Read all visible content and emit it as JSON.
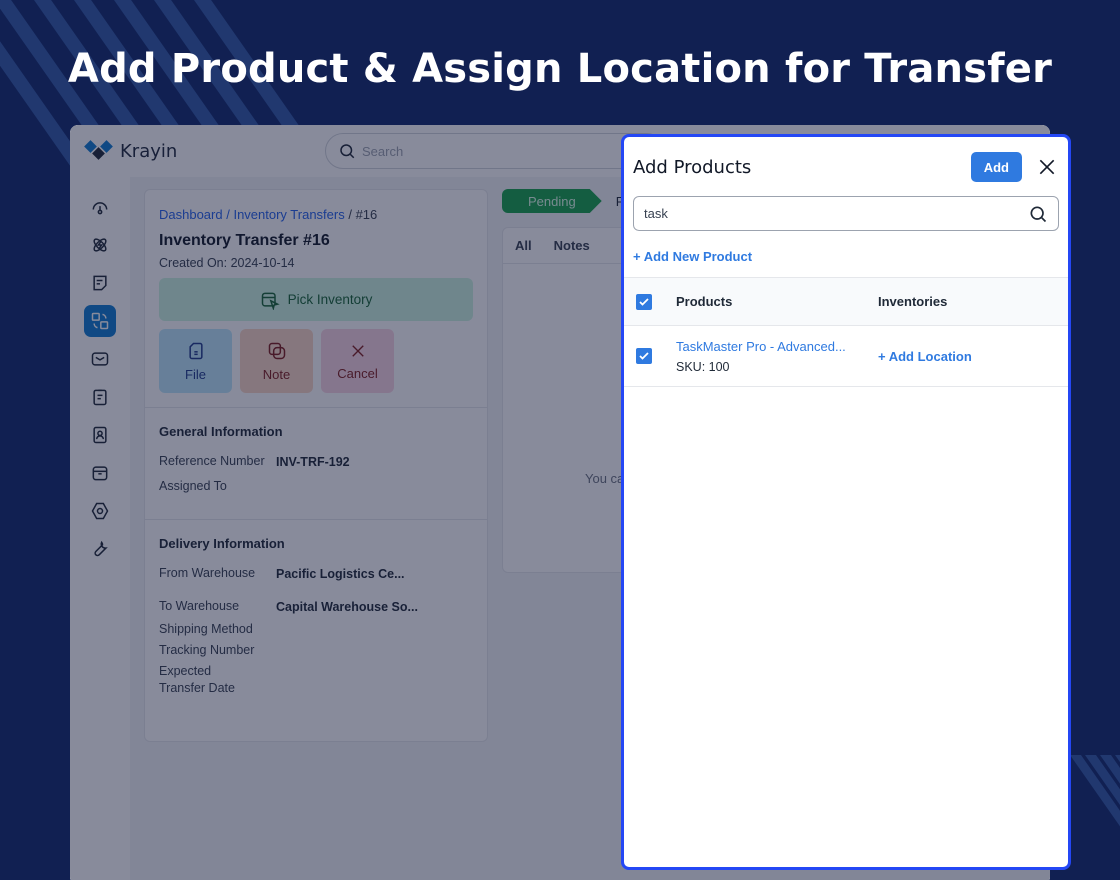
{
  "headline": "Add Product & Assign Location for Transfer",
  "app": {
    "brand": "Krayin",
    "search_placeholder": "Search",
    "sidebar": [
      {
        "icon": "dashboard-gauge-icon",
        "active": false
      },
      {
        "icon": "activity-atom-icon",
        "active": false
      },
      {
        "icon": "note-sticky-icon",
        "active": false
      },
      {
        "icon": "inventory-transfer-icon",
        "active": true
      },
      {
        "icon": "mail-icon",
        "active": false
      },
      {
        "icon": "clipboard-icon",
        "active": false
      },
      {
        "icon": "contacts-icon",
        "active": false
      },
      {
        "icon": "archive-box-icon",
        "active": false
      },
      {
        "icon": "settings-hex-icon",
        "active": false
      },
      {
        "icon": "wrench-icon",
        "active": false
      }
    ]
  },
  "transfer": {
    "breadcrumb": {
      "dashboard": "Dashboard",
      "sep1": " / ",
      "transfers": "Inventory Transfers",
      "sep2": " / ",
      "current": "#16"
    },
    "title": "Inventory Transfer #16",
    "created_on": "Created On: 2024-10-14",
    "pick_inventory": "Pick Inventory",
    "actions": {
      "file": "File",
      "note": "Note",
      "cancel": "Cancel"
    },
    "general": {
      "title": "General Information",
      "reference_label": "Reference Number",
      "reference_value": "INV-TRF-192",
      "assigned_label": "Assigned To",
      "assigned_value": ""
    },
    "delivery": {
      "title": "Delivery Information",
      "from_label": "From Warehouse",
      "from_value": "Pacific Logistics Ce...",
      "to_label": "To Warehouse",
      "to_value": "Capital Warehouse So...",
      "shipping_label": "Shipping Method",
      "tracking_label": "Tracking Number",
      "expected_label": "Expected Transfer Date"
    },
    "status": {
      "current": "Pending",
      "next": "P"
    },
    "tabs": {
      "all": "All",
      "notes": "Notes"
    },
    "empty_text": "You ca"
  },
  "modal": {
    "title": "Add Products",
    "add_label": "Add",
    "search_value": "task",
    "add_new_product": "+ Add New Product",
    "columns": {
      "products": "Products",
      "inventories": "Inventories"
    },
    "select_all_checked": true,
    "rows": [
      {
        "checked": true,
        "name": "TaskMaster Pro - Advanced...",
        "sku": "SKU: 100",
        "action": "+ Add Location"
      }
    ]
  }
}
